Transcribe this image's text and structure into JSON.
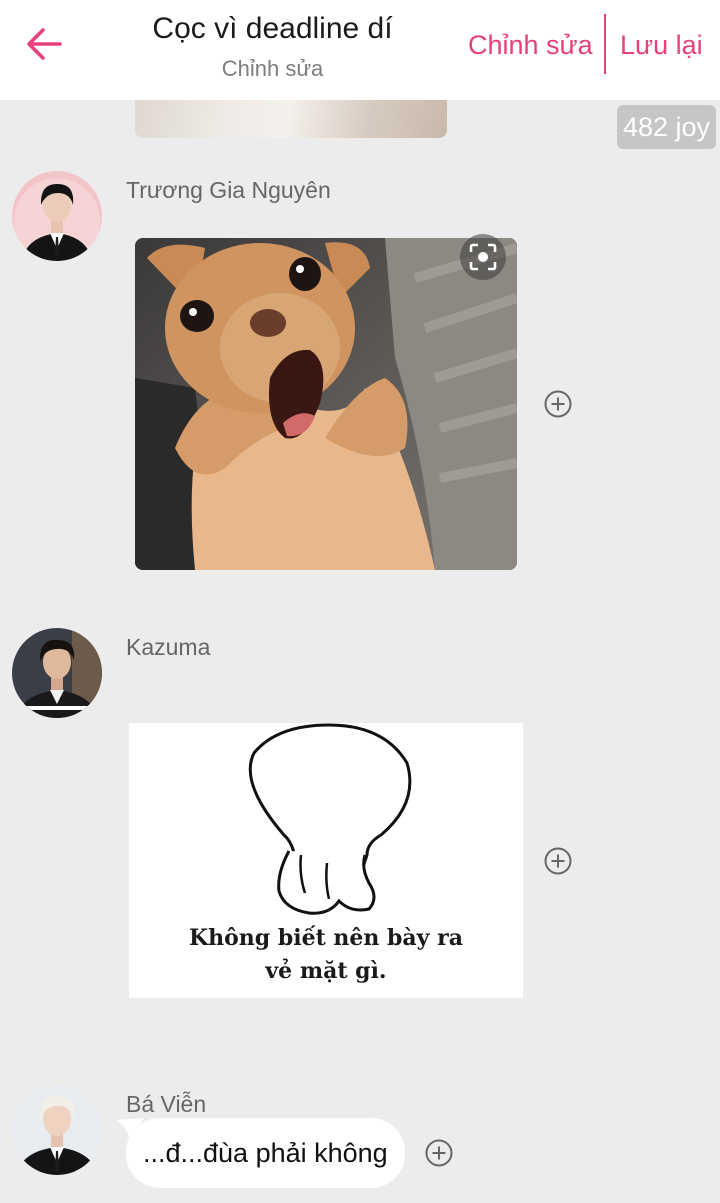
{
  "header": {
    "title": "Cọc vì deadline dí",
    "subtitle": "Chỉnh sửa",
    "edit_label": "Chỉnh sửa",
    "save_label": "Lưu lại",
    "accent": "#e8407d"
  },
  "reaction_badge": "482 joy",
  "messages": [
    {
      "sender": "Trương Gia Nguyên",
      "type": "image",
      "image": "surprised-chihuahua-meme"
    },
    {
      "sender": "Kazuma",
      "type": "image",
      "image": "blob-character-meme",
      "image_caption_lines": [
        "Không biết nên bày ra",
        "vẻ mặt gì."
      ]
    },
    {
      "sender": "Bá Viễn",
      "type": "text",
      "text": "...đ...đùa phải không"
    }
  ],
  "icons": {
    "back": "arrow-left-icon",
    "add": "plus-circle-icon",
    "scan": "scan-icon"
  },
  "colors": {
    "background": "#ececec",
    "header_bg": "#ffffff",
    "accent": "#e8407d",
    "badge_bg": "#c6c6c6"
  }
}
